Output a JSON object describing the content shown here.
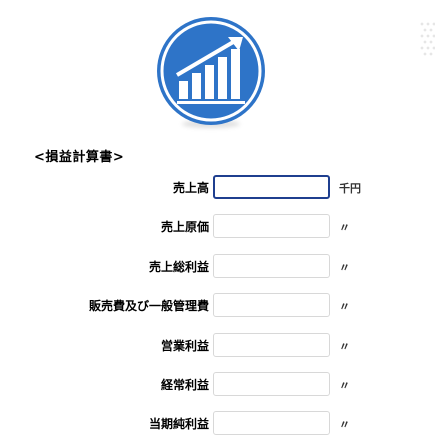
{
  "section": {
    "title": "<損益計算書>"
  },
  "form": {
    "rows": [
      {
        "label": "売上高",
        "value": "",
        "unit": "千円",
        "active": true
      },
      {
        "label": "売上原価",
        "value": "",
        "unit": "〃"
      },
      {
        "label": "売上総利益",
        "value": "",
        "unit": "〃"
      },
      {
        "label": "販売費及び一般管理費",
        "value": "",
        "unit": "〃"
      },
      {
        "label": "営業利益",
        "value": "",
        "unit": "〃"
      },
      {
        "label": "経常利益",
        "value": "",
        "unit": "〃"
      },
      {
        "label": "当期純利益",
        "value": "",
        "unit": "〃"
      }
    ]
  },
  "colors": {
    "logo": "#2e74c8",
    "active_border": "#1f3f8f"
  },
  "icons": {
    "logo": "bar-chart-growth-icon"
  }
}
